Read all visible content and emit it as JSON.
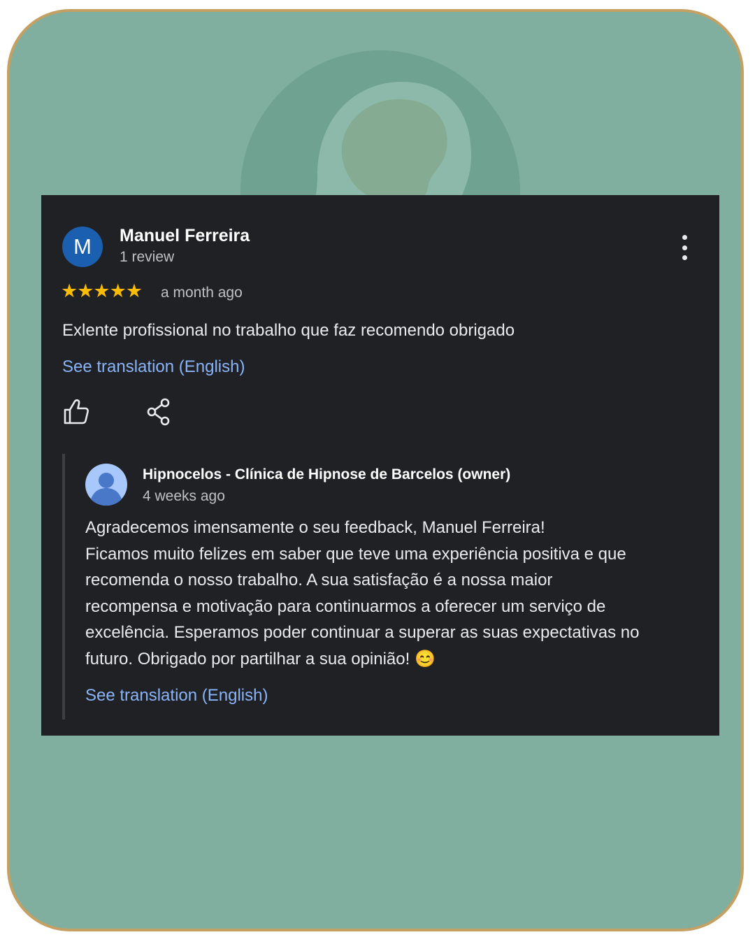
{
  "review": {
    "avatar_letter": "M",
    "name": "Manuel Ferreira",
    "meta": "1 review",
    "stars": "★★★★★",
    "rating": 5,
    "time": "a month ago",
    "text": "Exlente profissional no trabalho que faz recomendo obrigado",
    "translate_label": "See translation (English)"
  },
  "reply": {
    "name": "Hipnocelos - Clínica de Hipnose de Barcelos (owner)",
    "time": "4 weeks ago",
    "lines": [
      "Agradecemos imensamente o seu feedback, Manuel Ferreira!",
      "Ficamos muito felizes em saber que teve uma experiência positiva e que",
      "recomenda o nosso trabalho. A sua satisfação é a nossa maior",
      "recompensa e motivação para continuarmos a oferecer um serviço de",
      "excelência. Esperamos poder continuar a superar as suas expectativas no",
      "futuro. Obrigado por partilhar a sua opinião! 😊"
    ],
    "translate_label": "See translation (English)"
  },
  "colors": {
    "background": "#80ae9f",
    "frame_border": "#c4a063",
    "card": "#202124",
    "link": "#8ab4f8",
    "star": "#fbbc04",
    "avatar": "#1a5fb0"
  },
  "icons": {
    "more": "more-vert-icon",
    "like": "thumbs-up-icon",
    "share": "share-icon",
    "owner_avatar": "user-avatar-icon",
    "background_logo": "head-silhouette-icon"
  }
}
